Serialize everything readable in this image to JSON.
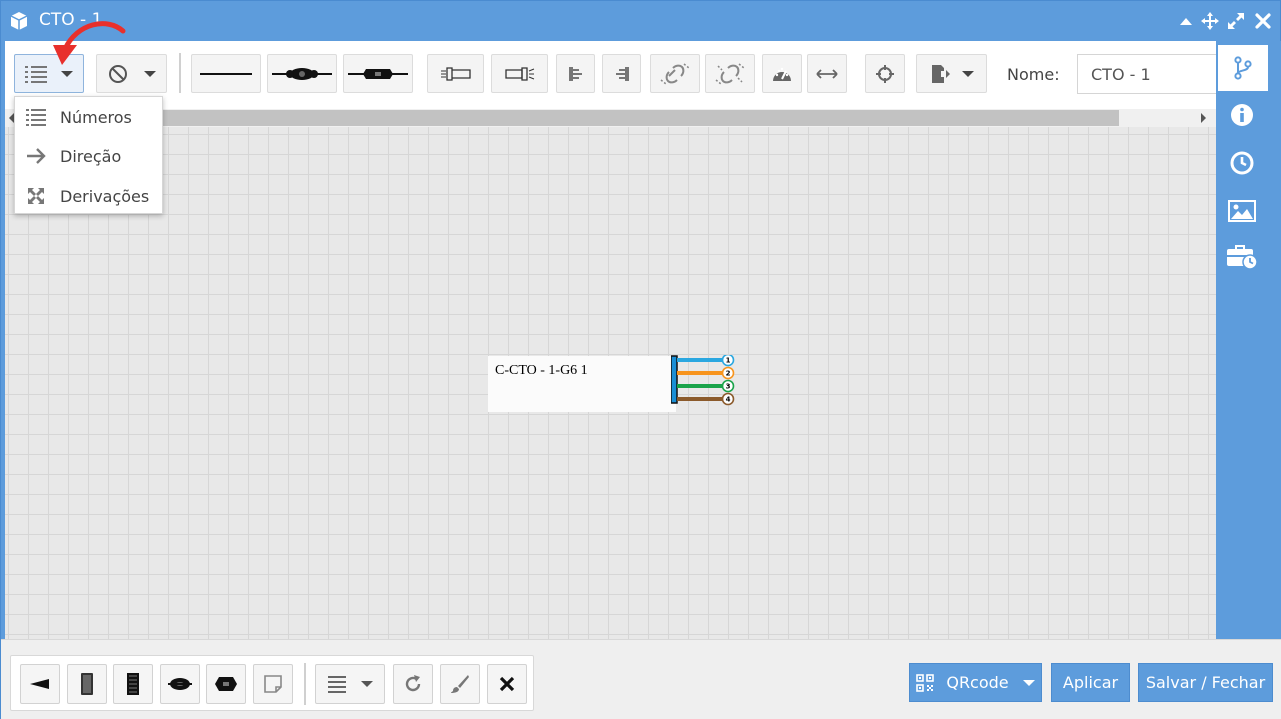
{
  "window": {
    "title": "CTO - 1"
  },
  "toolbar": {
    "name_label": "Nome:",
    "name_value": "CTO - 1"
  },
  "dropdown_menu": {
    "items": [
      {
        "label": "Números",
        "icon": "numbered-list-icon"
      },
      {
        "label": "Direção",
        "icon": "arrow-right-icon"
      },
      {
        "label": "Derivações",
        "icon": "expand-arrows-icon"
      }
    ]
  },
  "canvas": {
    "cable_label": "C-CTO - 1-G6 1",
    "fibers": [
      {
        "number": "1",
        "color": "#2aa7e0"
      },
      {
        "number": "2",
        "color": "#f7941d"
      },
      {
        "number": "3",
        "color": "#1aa34a"
      },
      {
        "number": "4",
        "color": "#8b5a2b"
      }
    ]
  },
  "footer": {
    "qrcode_label": "QRcode",
    "apply_label": "Aplicar",
    "save_close_label": "Salvar / Fechar"
  },
  "colors": {
    "accent": "#5d9cdc",
    "annotation_arrow": "#e8302c"
  }
}
